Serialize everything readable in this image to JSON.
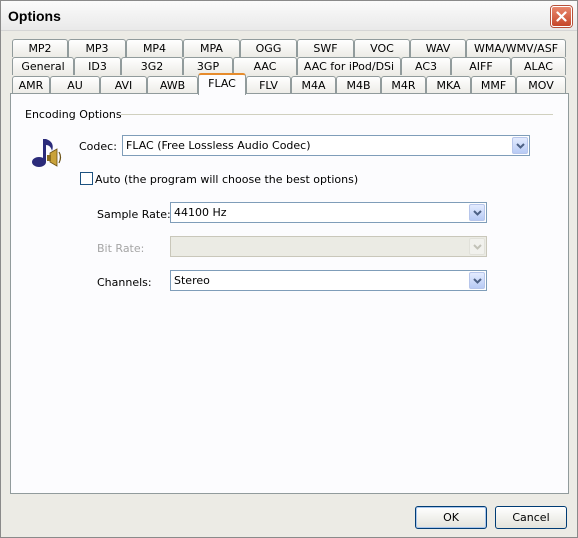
{
  "window": {
    "title": "Options"
  },
  "tab_rows": [
    [
      "MP2",
      "MP3",
      "MP4",
      "MPA",
      "OGG",
      "SWF",
      "VOC",
      "WAV",
      "WMA/WMV/ASF"
    ],
    [
      "General",
      "ID3",
      "3G2",
      "3GP",
      "AAC",
      "AAC for iPod/DSi",
      "AC3",
      "AIFF",
      "ALAC"
    ],
    [
      "AMR",
      "AU",
      "AVI",
      "AWB",
      "FLAC",
      "FLV",
      "M4A",
      "M4B",
      "M4R",
      "MKA",
      "MMF",
      "MOV"
    ]
  ],
  "active_tab": "FLAC",
  "encoding": {
    "group_label": "Encoding Options",
    "codec_label": "Codec:",
    "codec_value": "FLAC (Free Lossless Audio Codec)",
    "auto_label": "Auto (the program will choose the best options)",
    "auto_checked": false,
    "sample_rate_label": "Sample Rate:",
    "sample_rate_value": "44100 Hz",
    "bit_rate_label": "Bit Rate:",
    "bit_rate_value": "",
    "channels_label": "Channels:",
    "channels_value": "Stereo"
  },
  "buttons": {
    "ok": "OK",
    "cancel": "Cancel"
  },
  "icons": {
    "close": "close-icon",
    "music": "music-note-speaker-icon",
    "dropdown": "chevron-down-icon"
  },
  "colors": {
    "active_tab_accent": "#e68b2c",
    "close_button": "#c5472a",
    "button_border": "#003c74"
  }
}
